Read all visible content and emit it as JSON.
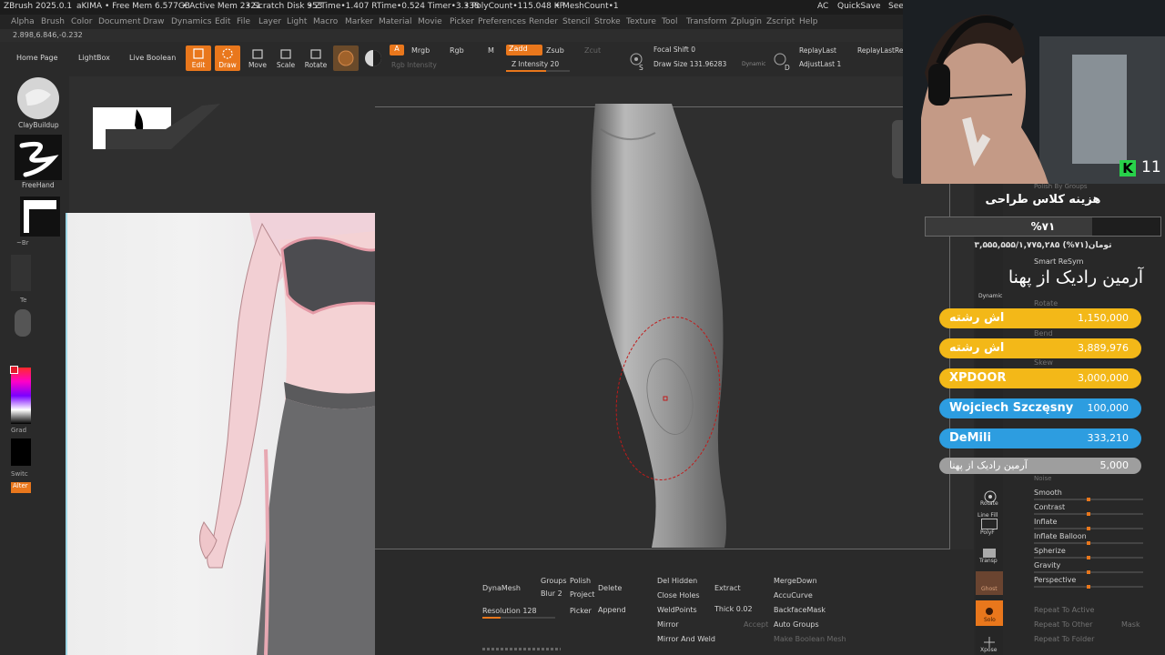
{
  "titlebar": {
    "app": "ZBrush 2025.0.1",
    "user": "aKIMA",
    "free_mem": "• Free Mem 6.577GB",
    "active_mem": "• Active Mem 2321",
    "scratch": "• Scratch Disk 953",
    "ztime": "• ZTime•1.407 RTime•0.524 Timer•3.338",
    "polycount": "• PolyCount•115.048 KP",
    "meshcount": "• MeshCount•1",
    "ac": "AC",
    "quicksave": "QuickSave",
    "see": "See"
  },
  "menu": [
    "Alpha",
    "Brush",
    "Color",
    "Document",
    "Draw",
    "Dynamics",
    "Edit",
    "File",
    "Layer",
    "Light",
    "Macro",
    "Marker",
    "Material",
    "Movie",
    "Picker",
    "Preferences",
    "Render",
    "Stencil",
    "Stroke",
    "Texture",
    "Tool",
    "Transform",
    "Zplugin",
    "Zscript",
    "Help"
  ],
  "coords": "2.898,6.846,-0.232",
  "toolbar": {
    "home_page": "Home Page",
    "lightbox": "LightBox",
    "live_boolean": "Live Boolean",
    "edit": "Edit",
    "draw": "Draw",
    "move": "Move",
    "scale": "Scale",
    "rotate": "Rotate",
    "a": "A",
    "mrgb": "Mrgb",
    "rgb": "Rgb",
    "m": "M",
    "rgb_intensity": "Rgb Intensity",
    "zadd": "Zadd",
    "zsub": "Zsub",
    "zcut": "Zcut",
    "z_intensity": "Z Intensity 20",
    "focal_shift": "Focal Shift 0",
    "draw_size": "Draw Size 131.96283",
    "dynamic": "Dynamic",
    "s_label": "S",
    "d_label": "D",
    "replay_last": "ReplayLast",
    "replay_last_rel": "ReplayLastRel",
    "adjust_last": "AdjustLast 1"
  },
  "leftshelf": {
    "clay_buildup": "ClayBuildup",
    "freehand": "FreeHand",
    "brush_short": "~Br",
    "te": "Te",
    "grad": "Grad",
    "switch": "Switc",
    "alternate": "Alter"
  },
  "bottom": {
    "dynamesh": "DynaMesh",
    "groups": "Groups",
    "polish": "Polish",
    "blur": "Blur 2",
    "project": "Project",
    "resolution": "Resolution 128",
    "picker": "Picker",
    "delete": "Delete",
    "append": "Append",
    "del_hidden": "Del Hidden",
    "close_holes": "Close Holes",
    "weld_points": "WeldPoints",
    "mirror": "Mirror",
    "mirror_and_weld": "Mirror And Weld",
    "extract": "Extract",
    "thick": "Thick 0.02",
    "accept": "Accept",
    "merge_down": "MergeDown",
    "accu_curve": "AccuCurve",
    "backface_mask": "BackfaceMask",
    "auto_groups": "Auto Groups",
    "make_boolean_mesh": "Make Boolean Mesh"
  },
  "rightpanel": {
    "polish_by_groups": "Polish By Groups",
    "smart_resym": "Smart ReSym",
    "rotate": "Rotate",
    "bend": "Bend",
    "skew": "Skew",
    "noise": "Noise",
    "smooth": "Smooth",
    "contrast": "Contrast",
    "inflate": "Inflate",
    "inflate_balloon": "Inflate Balloon",
    "spherize": "Spherize",
    "gravity": "Gravity",
    "perspective": "Perspective",
    "repeat_to_active": "Repeat To Active",
    "repeat_to_other": "Repeat To Other",
    "mask": "Mask",
    "repeat_to_folder": "Repeat To Folder",
    "icon_rotate": "Rotate",
    "icon_line_fill": "Line Fill",
    "icon_polyf": "PolyF",
    "icon_transp": "Transp",
    "icon_ghost": "Ghost",
    "icon_solo": "Solo",
    "icon_xpose": "Xpose",
    "icon_dynamic": "Dynamic"
  },
  "stream": {
    "k_badge": "K",
    "viewer_count": "11",
    "course_title": "هزینه کلاس طراحی",
    "percent": "%۷۱",
    "progress_fraction": 0.71,
    "progress_text": "۳,۵۵۵,۵۵۵/۱,۷۷۵,۲۸۵ تومان(۷۱%)",
    "latest_donor": "آرمین رادیک از پهنا",
    "donations": [
      {
        "name": "اش رشته",
        "amount": "1,150,000",
        "color": "#f3b818"
      },
      {
        "name": "اش رشته",
        "amount": "3,889,976",
        "color": "#f3b818"
      },
      {
        "name": "XPDOOR",
        "amount": "3,000,000",
        "color": "#f3b818"
      },
      {
        "name": "Wojciech Szczęsny",
        "amount": "100,000",
        "color": "#2d9de0"
      },
      {
        "name": "DeMili",
        "amount": "333,210",
        "color": "#2d9de0"
      },
      {
        "name": "آرمین رادیک از پهنا",
        "amount": "5,000",
        "color": "#9e9e9e"
      }
    ]
  },
  "colors": {
    "accent": "#e9771c",
    "gold": "#f3b818",
    "blue": "#2d9de0",
    "grey": "#9e9e9e",
    "stream_green": "#28d24a"
  }
}
